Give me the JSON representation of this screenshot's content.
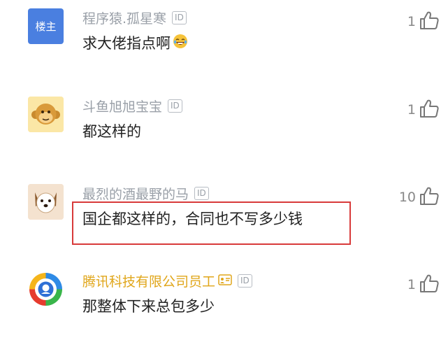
{
  "comments": [
    {
      "username": "程序猿.孤星寒",
      "avatar_label": "楼主",
      "id_badge": "ID",
      "text": "求大佬指点啊",
      "emoji": "grinning-sweat-emoji",
      "likes": "1",
      "avatar": "blue-square-owner"
    },
    {
      "username": "斗鱼旭旭宝宝",
      "id_badge": "ID",
      "text": "都这样的",
      "likes": "1",
      "avatar": "monkey-icon"
    },
    {
      "username": "最烈的酒最野的马",
      "id_badge": "ID",
      "text": "国企都这样的，合同也不写多少钱",
      "likes": "10",
      "avatar": "dog-icon",
      "highlighted": true
    },
    {
      "username": "腾讯科技有限公司员工",
      "id_badge": "ID",
      "text": "那整体下来总包多少",
      "likes": "1",
      "avatar": "tencent-news-icon",
      "verified_icon": "employee-badge-icon"
    }
  ],
  "colors": {
    "username_gray": "#9aa0a8",
    "username_gold": "#e0a61a",
    "owner_avatar": "#4a7fe0",
    "highlight": "#d83a3a"
  }
}
